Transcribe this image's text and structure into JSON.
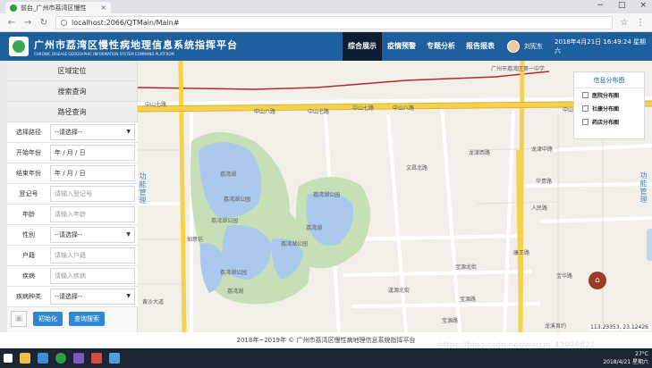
{
  "browser": {
    "tab_title": "前台_广州市荔湾区慢性",
    "url": "localhost:2066/QTMain/Main#"
  },
  "header": {
    "title": "广州市荔湾区慢性病地理信息系统指挥平台",
    "subtitle": "CHRONIC DISEASE GEOGRAPHIC INFORMATION SYSTEM COMMAND PLATFROM",
    "menu": [
      {
        "label": "综合展示",
        "active": true
      },
      {
        "label": "疫情预警",
        "active": false
      },
      {
        "label": "专题分析",
        "active": false
      },
      {
        "label": "报告报表",
        "active": false
      }
    ],
    "user": "刘宪东",
    "datetime": "2018年4月21日 16:49:24 星期六"
  },
  "sidebar": {
    "tabs": [
      "区域定位",
      "搜索查询",
      "路径查询"
    ],
    "fields": [
      {
        "label": "选择路径",
        "value": "--请选择--",
        "type": "select"
      },
      {
        "label": "开始年份",
        "value": "年 / 月 / 日",
        "type": "date"
      },
      {
        "label": "结束年份",
        "value": "年 / 月 / 日",
        "type": "date"
      },
      {
        "label": "登记号",
        "value": "请输入登记号",
        "type": "text"
      },
      {
        "label": "年龄",
        "value": "请输入年龄",
        "type": "text"
      },
      {
        "label": "性别",
        "value": "--请选择--",
        "type": "select"
      },
      {
        "label": "户籍",
        "value": "请输入户籍",
        "type": "text"
      },
      {
        "label": "疾病",
        "value": "请输入疾病",
        "type": "text"
      },
      {
        "label": "疾病种类",
        "value": "--请选择--",
        "type": "select"
      }
    ],
    "buttons": {
      "init": "初始化",
      "search": "查询搜索"
    }
  },
  "info_panel": {
    "title": "信息分布图",
    "options": [
      "医院分布图",
      "社康分布图",
      "药店分布图"
    ]
  },
  "map": {
    "labels": [
      "中山八路",
      "中山七路",
      "中山八路",
      "中山八路",
      "荔湾湖",
      "荔湾湖公园",
      "荔湾湖公园",
      "荔湾湖公园",
      "荔湾湖",
      "荔湾湖",
      "荔湾湖公园",
      "荔湾湖公园",
      "龙津西路",
      "龙津中路",
      "逢源北街",
      "宝源北街",
      "宝源路",
      "康王路",
      "人民路",
      "华贵路",
      "广州市荔湾区第一中学",
      "如意坊",
      "黄沙大道",
      "龙溪首约",
      "宝华路",
      "文昌北路",
      "中山七路",
      "中山七路",
      "宝源路"
    ],
    "side_labels": {
      "left": "功能管理",
      "right": "功能管理"
    },
    "coordinates": "113.23353, 23.12426"
  },
  "footer": "2018年~2019年 © 广州市荔湾区慢性病地理信息系统指挥平台",
  "watermark": "https://blog.csdn.net/weixin_43976821",
  "taskbar": {
    "temp": "27°C",
    "date": "2018/4/21 星期六"
  }
}
